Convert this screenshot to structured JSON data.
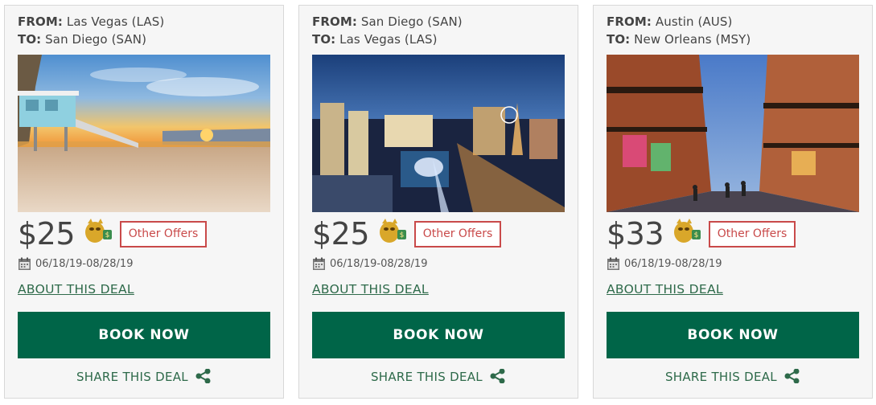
{
  "labels": {
    "from": "FROM:",
    "to": "TO:",
    "other_offers": "Other Offers",
    "about": "ABOUT THIS DEAL",
    "book": "BOOK NOW",
    "share": "SHARE THIS DEAL"
  },
  "colors": {
    "brand_green": "#006548",
    "link_green": "#2e6a4a",
    "offer_red": "#c94a4a"
  },
  "deals": [
    {
      "from": "Las Vegas (LAS)",
      "to": "San Diego (SAN)",
      "price": "$25",
      "dates": "06/18/19-08/28/19",
      "photo": "beach-lifeguard-tower-sunset"
    },
    {
      "from": "San Diego (SAN)",
      "to": "Las Vegas (LAS)",
      "price": "$25",
      "dates": "06/18/19-08/28/19",
      "photo": "las-vegas-strip-night"
    },
    {
      "from": "Austin (AUS)",
      "to": "New Orleans (MSY)",
      "price": "$33",
      "dates": "06/18/19-08/28/19",
      "photo": "new-orleans-bourbon-street"
    }
  ]
}
